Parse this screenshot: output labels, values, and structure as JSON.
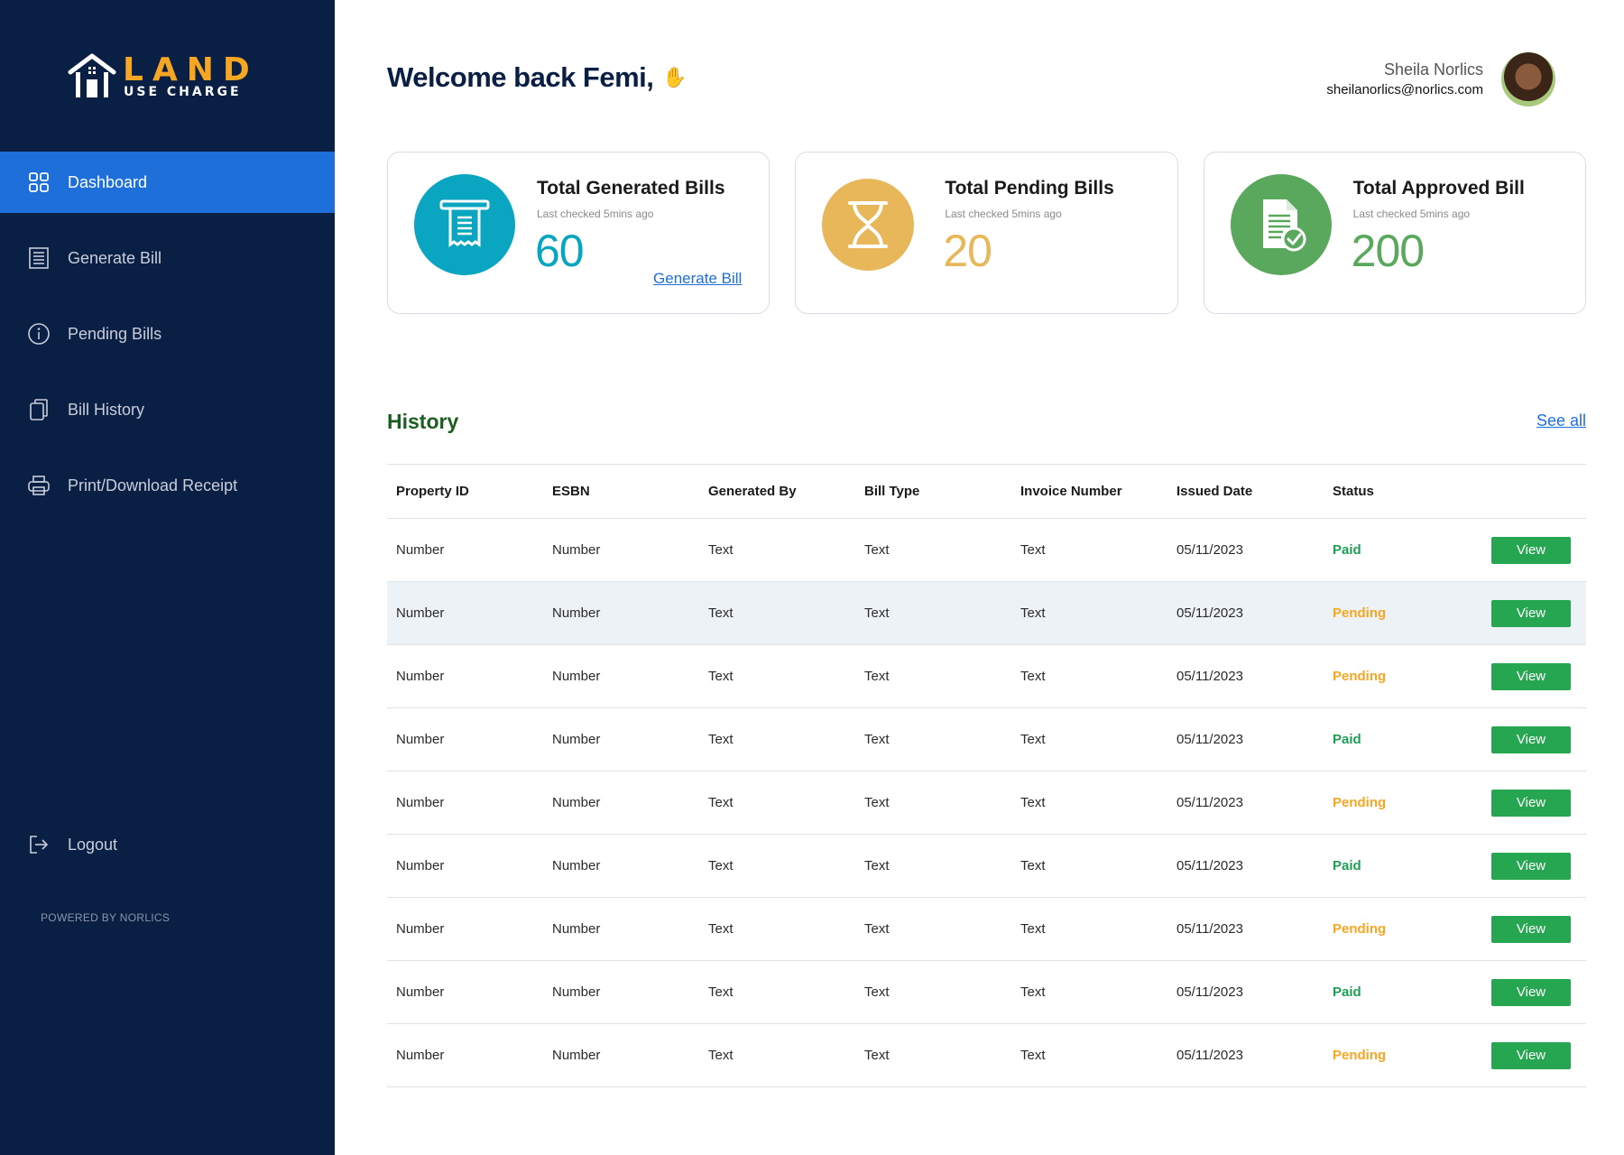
{
  "logo": {
    "main": "LAND",
    "sub": "USE CHARGE"
  },
  "sidebar": {
    "items": [
      {
        "label": "Dashboard",
        "icon": "grid-icon",
        "active": true
      },
      {
        "label": "Generate Bill",
        "icon": "receipt-icon",
        "active": false
      },
      {
        "label": "Pending Bills",
        "icon": "info-icon",
        "active": false
      },
      {
        "label": "Bill History",
        "icon": "copy-icon",
        "active": false
      },
      {
        "label": "Print/Download Receipt",
        "icon": "printer-icon",
        "active": false
      }
    ],
    "logout": {
      "label": "Logout",
      "icon": "logout-icon"
    },
    "powered_by": "POWERED BY NORLICS"
  },
  "header": {
    "welcome": "Welcome back Femi,",
    "wave_icon": "waving-hand-icon",
    "user": {
      "name": "Sheila Norlics",
      "email": "sheilanorlics@norlics.com"
    }
  },
  "cards": [
    {
      "title": "Total Generated Bills",
      "subtitle": "Last checked 5mins ago",
      "value": "60",
      "link": "Generate Bill",
      "color": "#0aa5c0",
      "icon": "receipt-icon"
    },
    {
      "title": "Total Pending Bills",
      "subtitle": "Last checked 5mins ago",
      "value": "20",
      "color": "#e8b75a",
      "icon": "hourglass-icon"
    },
    {
      "title": "Total Approved Bill",
      "subtitle": "Last checked 5mins ago",
      "value": "200",
      "color": "#5aa85e",
      "icon": "approved-document-icon"
    }
  ],
  "history": {
    "title": "History",
    "see_all": "See all",
    "columns": [
      "Property ID",
      "ESBN",
      "Generated By",
      "Bill Type",
      "Invoice Number",
      "Issued Date",
      "Status"
    ],
    "view_label": "View",
    "rows": [
      {
        "property_id": "Number",
        "esbn": "Number",
        "generated_by": "Text",
        "bill_type": "Text",
        "invoice_number": "Text",
        "issued_date": "05/11/2023",
        "status": "Paid"
      },
      {
        "property_id": "Number",
        "esbn": "Number",
        "generated_by": "Text",
        "bill_type": "Text",
        "invoice_number": "Text",
        "issued_date": "05/11/2023",
        "status": "Pending"
      },
      {
        "property_id": "Number",
        "esbn": "Number",
        "generated_by": "Text",
        "bill_type": "Text",
        "invoice_number": "Text",
        "issued_date": "05/11/2023",
        "status": "Pending"
      },
      {
        "property_id": "Number",
        "esbn": "Number",
        "generated_by": "Text",
        "bill_type": "Text",
        "invoice_number": "Text",
        "issued_date": "05/11/2023",
        "status": "Paid"
      },
      {
        "property_id": "Number",
        "esbn": "Number",
        "generated_by": "Text",
        "bill_type": "Text",
        "invoice_number": "Text",
        "issued_date": "05/11/2023",
        "status": "Pending"
      },
      {
        "property_id": "Number",
        "esbn": "Number",
        "generated_by": "Text",
        "bill_type": "Text",
        "invoice_number": "Text",
        "issued_date": "05/11/2023",
        "status": "Paid"
      },
      {
        "property_id": "Number",
        "esbn": "Number",
        "generated_by": "Text",
        "bill_type": "Text",
        "invoice_number": "Text",
        "issued_date": "05/11/2023",
        "status": "Pending"
      },
      {
        "property_id": "Number",
        "esbn": "Number",
        "generated_by": "Text",
        "bill_type": "Text",
        "invoice_number": "Text",
        "issued_date": "05/11/2023",
        "status": "Paid"
      },
      {
        "property_id": "Number",
        "esbn": "Number",
        "generated_by": "Text",
        "bill_type": "Text",
        "invoice_number": "Text",
        "issued_date": "05/11/2023",
        "status": "Pending"
      }
    ]
  },
  "colors": {
    "sidebar": "#0a1f44",
    "accent": "#1e6fd9",
    "paid": "#1f9d55",
    "pending": "#f5a623",
    "view_button": "#27a652",
    "logo": "#f5a623"
  }
}
